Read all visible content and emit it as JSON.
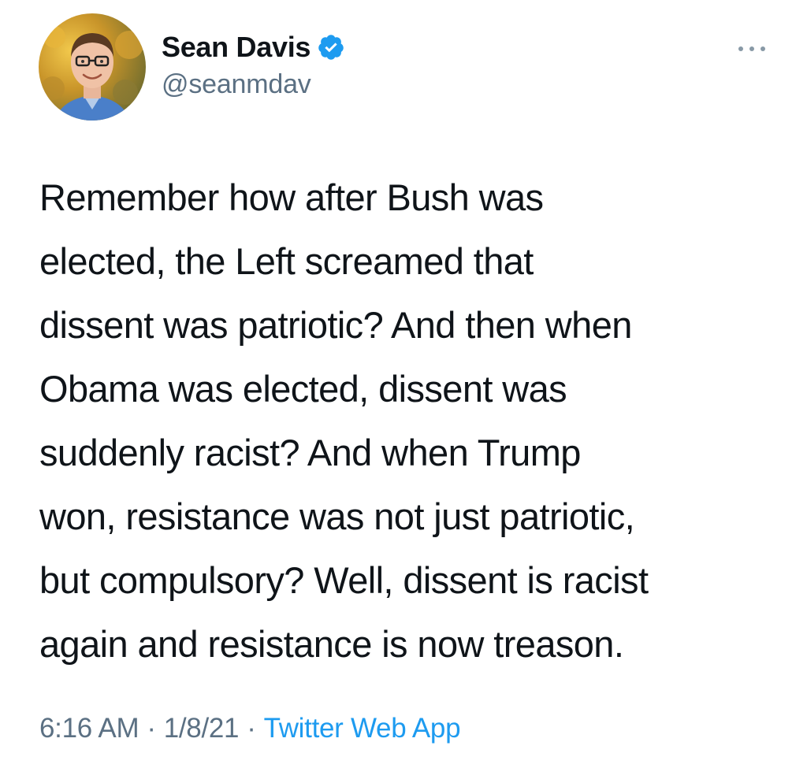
{
  "tweet": {
    "author": {
      "display_name": "Sean Davis",
      "handle": "@seanmdav",
      "verified": true,
      "verified_color": "#1d9bf0"
    },
    "text_lines": [
      "Remember how after Bush was",
      "elected, the Left screamed that",
      "dissent was patriotic? And then when",
      "Obama was elected, dissent was",
      "suddenly racist? And when Trump",
      "won, resistance was not just patriotic,",
      "but compulsory? Well, dissent is racist",
      "again and resistance is now treason."
    ],
    "time": "6:16 AM",
    "date": "1/8/21",
    "separator": "·",
    "source": "Twitter Web App"
  },
  "icons": {
    "more": "more-horizontal-icon",
    "verified": "verified-badge-icon"
  },
  "colors": {
    "text": "#0f1419",
    "secondary": "#5b7083",
    "link": "#1d9bf0",
    "background": "#ffffff"
  }
}
